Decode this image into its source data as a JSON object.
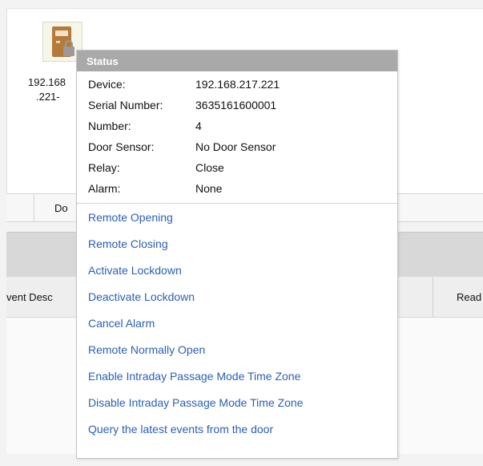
{
  "door": {
    "icon": "door-lock-icon",
    "label_line1": "192.168",
    "label_line2": ".221-"
  },
  "strip": {
    "column_partial": "Do"
  },
  "table": {
    "header_left_partial": "vent Desc",
    "header_right_partial": "Read"
  },
  "popup": {
    "title": "Status",
    "fields": [
      {
        "key": "Device:",
        "value": "192.168.217.221"
      },
      {
        "key": "Serial Number:",
        "value": "3635161600001"
      },
      {
        "key": "Number:",
        "value": "4"
      },
      {
        "key": "Door Sensor:",
        "value": "No Door Sensor"
      },
      {
        "key": "Relay:",
        "value": "Close"
      },
      {
        "key": "Alarm:",
        "value": "None"
      }
    ],
    "actions": [
      "Remote Opening",
      "Remote Closing",
      "Activate Lockdown",
      "Deactivate Lockdown",
      "Cancel Alarm",
      "Remote Normally Open",
      "Enable Intraday Passage Mode Time Zone",
      "Disable Intraday Passage Mode Time Zone",
      "Query the latest events from the door"
    ]
  },
  "colors": {
    "link": "#2a5fb5",
    "header": "#a9a9a9",
    "door": "#b57a3a"
  }
}
